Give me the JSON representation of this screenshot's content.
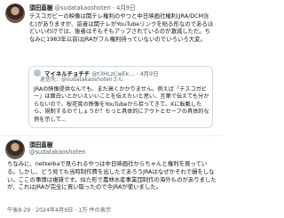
{
  "tweet1": {
    "display_name": "須田直樹",
    "handle": "@sudatakaoshoten",
    "date": "4月9日",
    "body": "テスコガビーの映像は関テレ権利のやつと中日映画社権利(JRA/DCM含む)がありますが、前者は関テレがYouTubeリンクを貼る形なのであるほどいいわけでは、後者はそもそもアップされているのが激減しただ。ちなみに1983年以前はJRAがフル権利持っていないのでいろいろ大変。"
  },
  "quote": {
    "display_name": "マイネルチョチチ",
    "handle": "@t3HLzCwEk...",
    "date": "4月9日",
    "reply_to": "返信先：@sudatakaoshotenさん",
    "body": "JRAの映像提供なんでも、まだ高くかかりません。例えば「テスコガビー」は面白いとかいえいいことを伝えたいと思い、言葉で伝えても分からないので、桜花賞の映像をYouTubeから拾ってきて、Xに転載したら、規制するのでしょうか？ちっと具体的にアウトとセーフの具体的な例を示して..."
  },
  "tweet2": {
    "display_name": "須田直樹",
    "handle": "@sudatakaoshoten",
    "body": "ちなみに、netkeibaで見られるやつは中日映画社からちゃんと権利を買っている。しかし、どう見ても当時制作費を出したであろうJRAはなぜかそれで損をしない。ここの事情は複雑です。似た形で農林水産事業団制作の海外ものがありましたが、これはJRAが完全に買い取ったので今JRAが使いました。",
    "timestamp": "午後8:29 · 2024年4月9日 · 1万 件の表示"
  }
}
